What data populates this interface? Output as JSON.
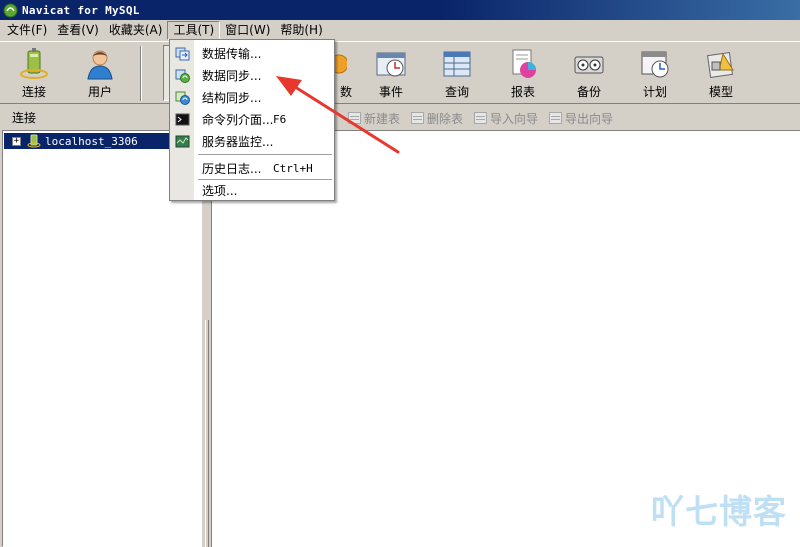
{
  "window": {
    "title": "Navicat for MySQL"
  },
  "menubar": {
    "items": [
      {
        "label": "文件(F)"
      },
      {
        "label": "查看(V)"
      },
      {
        "label": "收藏夹(A)"
      },
      {
        "label": "工具(T)"
      },
      {
        "label": "窗口(W)"
      },
      {
        "label": "帮助(H)"
      }
    ]
  },
  "toolbar": {
    "connect_label": "连接",
    "user_label": "用户",
    "partial_label": "数",
    "event_label": "事件",
    "query_label": "查询",
    "report_label": "报表",
    "backup_label": "备份",
    "schedule_label": "计划",
    "model_label": "模型"
  },
  "left_panel": {
    "header": "连接",
    "tree": [
      {
        "label": "localhost_3306",
        "expander": "+"
      }
    ]
  },
  "object_toolbar": {
    "new_table": "新建表",
    "delete_table": "删除表",
    "import_wizard": "导入向导",
    "export_wizard": "导出向导"
  },
  "tools_menu": {
    "items": [
      {
        "label": "数据传输..."
      },
      {
        "label": "数据同步..."
      },
      {
        "label": "结构同步..."
      },
      {
        "label": "命令列介面...",
        "shortcut": "F6"
      },
      {
        "label": "服务器监控..."
      },
      {
        "label": "历史日志...",
        "shortcut": "Ctrl+H"
      },
      {
        "label": "选项..."
      }
    ]
  },
  "watermark": "吖七博客",
  "colors": {
    "titlebar": "#0a246a",
    "selection": "#0a246a",
    "annotation_arrow": "#e8372c",
    "watermark": "#bfe0f4"
  }
}
